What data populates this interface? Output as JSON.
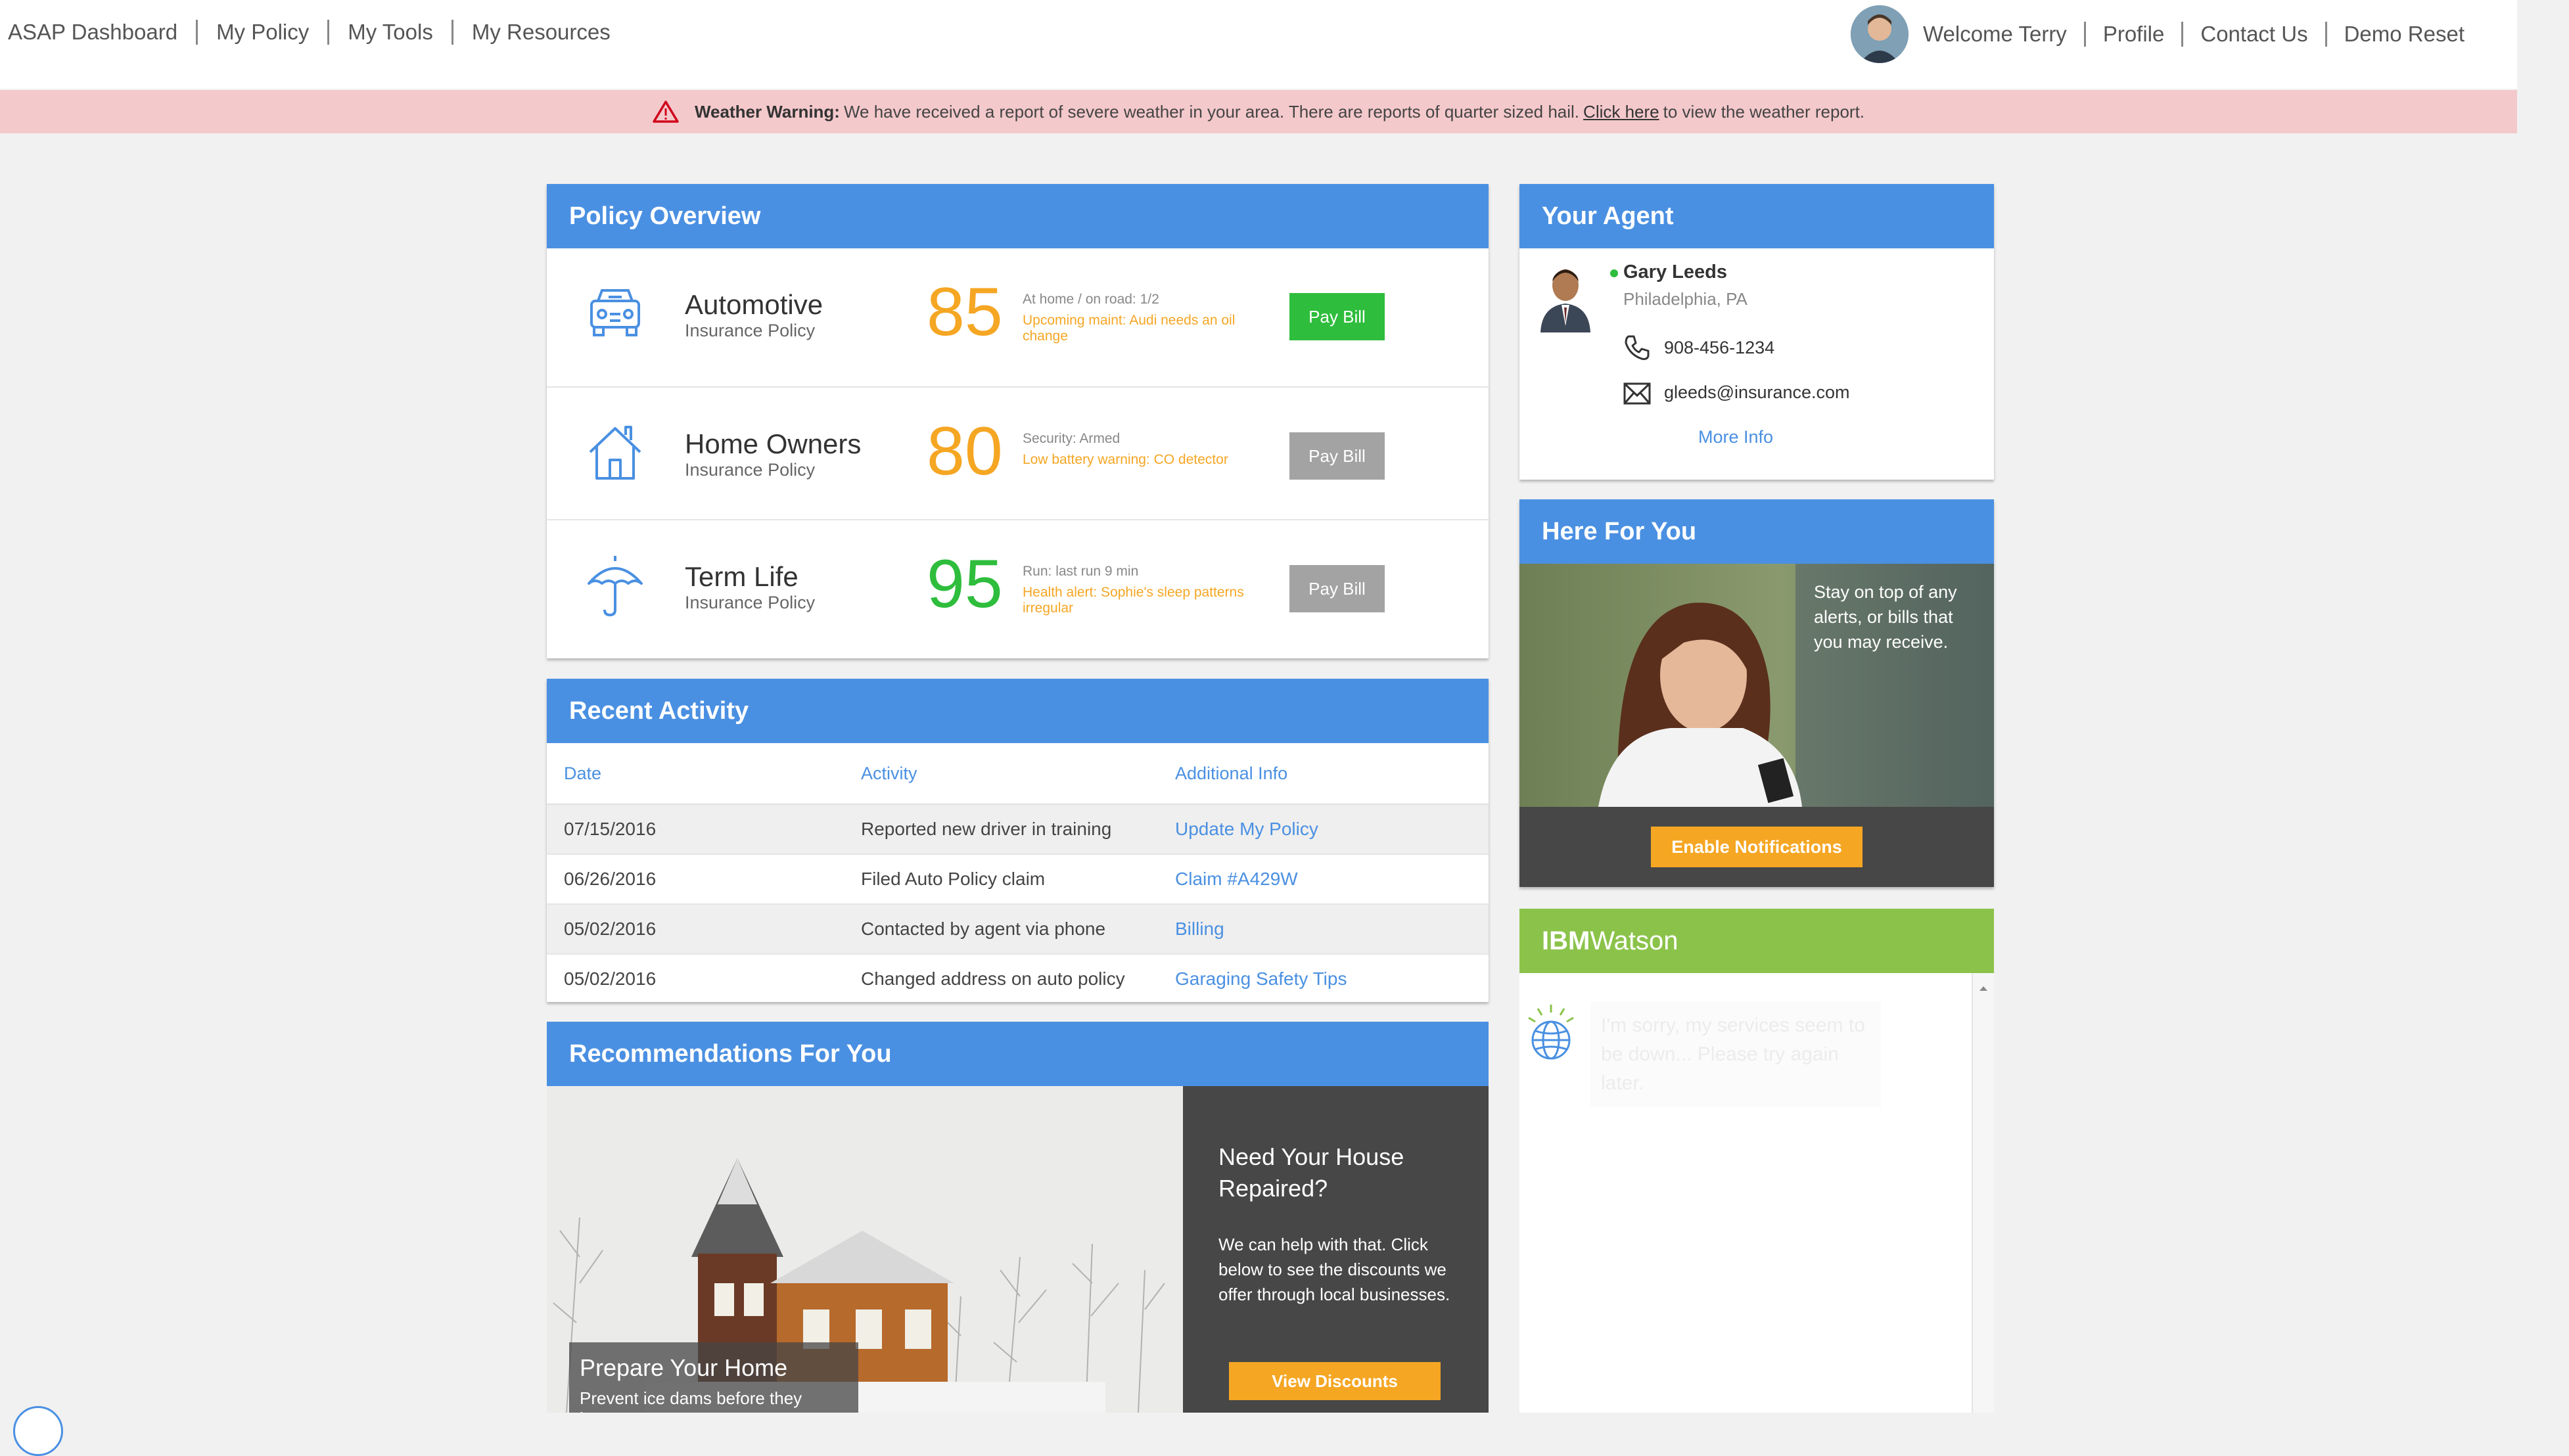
{
  "nav": {
    "links": [
      "ASAP Dashboard",
      "My Policy",
      "My Tools",
      "My Resources"
    ],
    "welcome": "Welcome Terry",
    "right_links": [
      "Profile",
      "Contact Us",
      "Demo Reset"
    ]
  },
  "warning": {
    "label": "Weather Warning:",
    "text": "We have received a report of severe weather in your area. There are reports of quarter sized hail.",
    "link": "Click here",
    "suffix": "to view the weather report."
  },
  "policy": {
    "title": "Policy Overview",
    "items": [
      {
        "name": "Automotive",
        "sub": "Insurance Policy",
        "score": "85",
        "score_color": "#f5a623",
        "note1": "At home / on road: 1/2",
        "note2": "Upcoming maint: Audi needs an oil change",
        "button": "Pay Bill",
        "button_color": "#2ebd3c",
        "icon": "car-icon"
      },
      {
        "name": "Home Owners",
        "sub": "Insurance Policy",
        "score": "80",
        "score_color": "#f5a623",
        "note1": "Security: Armed",
        "note2": "Low battery warning: CO detector",
        "button": "Pay Bill",
        "button_color": "#a3a3a3",
        "icon": "house-icon"
      },
      {
        "name": "Term Life",
        "sub": "Insurance Policy",
        "score": "95",
        "score_color": "#2ebd3c",
        "note1": "Run: last run 9 min",
        "note2": "Health alert: Sophie's sleep patterns irregular",
        "button": "Pay Bill",
        "button_color": "#a3a3a3",
        "icon": "umbrella-icon"
      }
    ]
  },
  "activity": {
    "title": "Recent Activity",
    "headers": [
      "Date",
      "Activity",
      "Additional Info"
    ],
    "rows": [
      [
        "07/15/2016",
        "Reported new driver in training",
        "Update My Policy"
      ],
      [
        "06/26/2016",
        "Filed Auto Policy claim",
        "Claim #A429W"
      ],
      [
        "05/02/2016",
        "Contacted by agent via phone",
        "Billing"
      ],
      [
        "05/02/2016",
        "Changed address on auto policy",
        "Garaging Safety Tips"
      ]
    ]
  },
  "recommend": {
    "title": "Recommendations For You",
    "heading": "Need Your House Repaired?",
    "body": "We can help with that. Click below to see the discounts we offer through local businesses.",
    "button": "View Discounts",
    "caption_title": "Prepare Your Home",
    "caption_sub": "Prevent ice dams before they happen."
  },
  "agent": {
    "title": "Your Agent",
    "name": "Gary Leeds",
    "location": "Philadelphia, PA",
    "phone": "908-456-1234",
    "email": "gleeds@insurance.com",
    "more": "More Info"
  },
  "here": {
    "title": "Here For You",
    "text": "Stay on top of any alerts, or bills that you may receive.",
    "button": "Enable Notifications"
  },
  "watson": {
    "title_bold": "IBM",
    "title_light": "Watson",
    "message": "I'm sorry, my services seem to be down... Please try again later."
  },
  "colors": {
    "accent": "#4a90e2",
    "warning_bg": "#f4c9cc",
    "orange": "#f5a623",
    "green": "#2ebd3c",
    "watson": "#8bc34a"
  }
}
